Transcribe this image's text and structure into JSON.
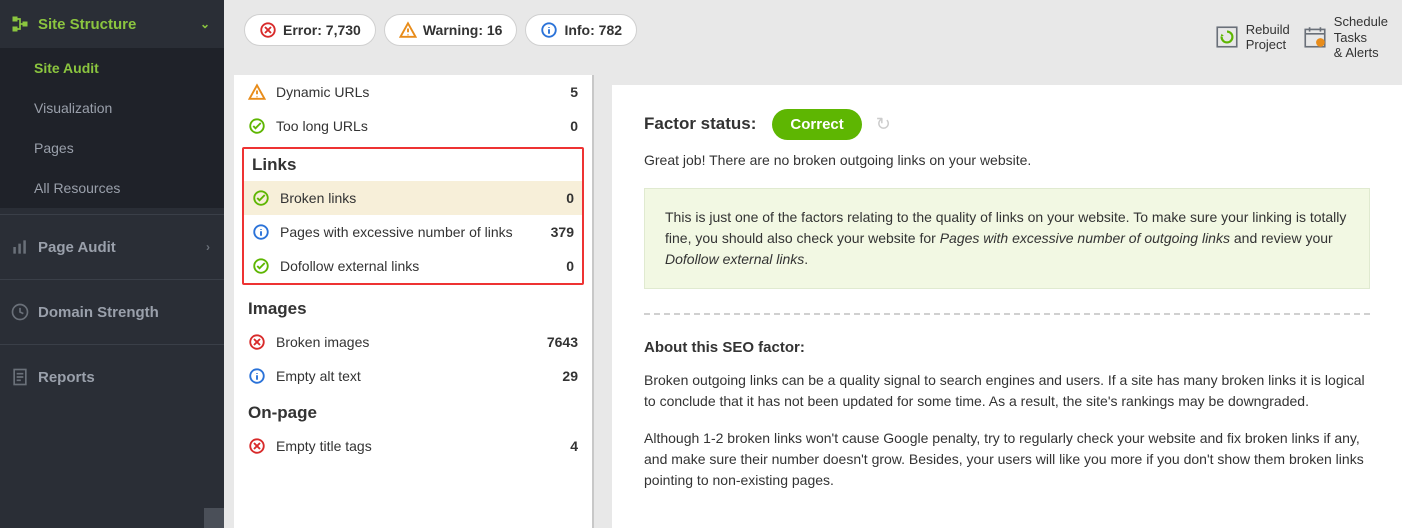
{
  "sidebar": {
    "header": "Site Structure",
    "sub": [
      "Site Audit",
      "Visualization",
      "Pages",
      "All Resources"
    ],
    "main": [
      "Page Audit",
      "Domain Strength",
      "Reports"
    ]
  },
  "toolbar": {
    "error_label": "Error:",
    "error_count": "7,730",
    "warning_label": "Warning:",
    "warning_count": "16",
    "info_label": "Info:",
    "info_count": "782",
    "rebuild": "Rebuild\nProject",
    "schedule": "Schedule\nTasks\n& Alerts"
  },
  "sections": {
    "top_rows": [
      {
        "icon": "warn",
        "label": "Dynamic URLs",
        "val": "5"
      },
      {
        "icon": "ok",
        "label": "Too long URLs",
        "val": "0"
      }
    ],
    "links_hdr": "Links",
    "links_rows": [
      {
        "icon": "ok",
        "label": "Broken links",
        "val": "0",
        "selected": true
      },
      {
        "icon": "info",
        "label": "Pages with excessive number of links",
        "val": "379"
      },
      {
        "icon": "ok",
        "label": "Dofollow external links",
        "val": "0"
      }
    ],
    "images_hdr": "Images",
    "images_rows": [
      {
        "icon": "err",
        "label": "Broken images",
        "val": "7643"
      },
      {
        "icon": "info",
        "label": "Empty alt text",
        "val": "29"
      }
    ],
    "onpage_hdr": "On-page",
    "onpage_rows": [
      {
        "icon": "err",
        "label": "Empty title tags",
        "val": "4"
      }
    ]
  },
  "right": {
    "fs_label": "Factor status:",
    "fs_badge": "Correct",
    "desc": "Great job! There are no broken outgoing links on your website.",
    "note_pre": "This is just one of the factors relating to the quality of links on your website. To make sure your linking is totally fine, you should also check your website for ",
    "note_em1": "Pages with excessive number of outgoing links",
    "note_mid": " and review your ",
    "note_em2": "Dofollow external links",
    "note_post": ".",
    "about_hdr": "About this SEO factor:",
    "about_p1": "Broken outgoing links can be a quality signal to search engines and users. If a site has many broken links it is logical to conclude that it has not been updated for some time. As a result, the site's rankings may be downgraded.",
    "about_p2": "Although 1-2 broken links won't cause Google penalty, try to regularly check your website and fix broken links if any, and make sure their number doesn't grow. Besides, your users will like you more if you don't show them broken links pointing to non-existing pages."
  }
}
